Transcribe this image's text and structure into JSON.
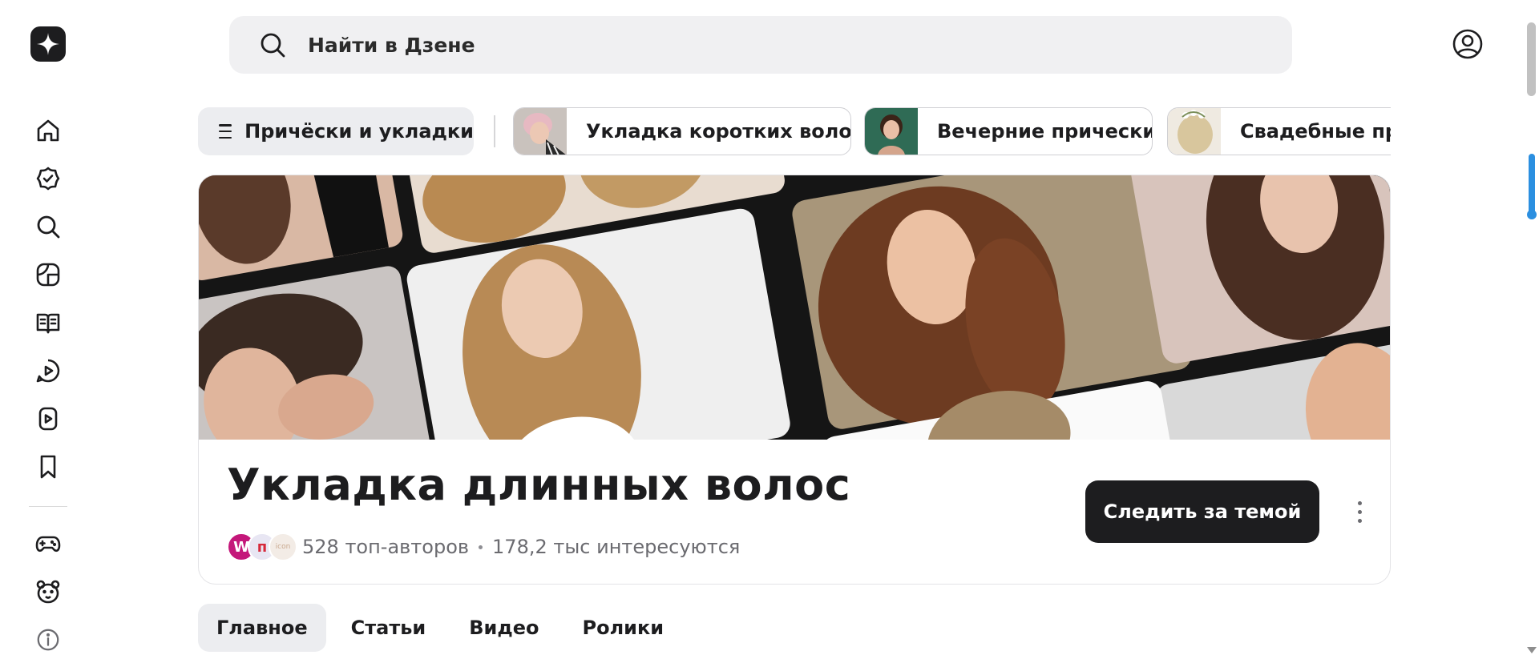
{
  "search": {
    "placeholder": "Найти в Дзене"
  },
  "rail": {
    "items": [
      {
        "icon": "home-icon"
      },
      {
        "icon": "subscriptions-icon"
      },
      {
        "icon": "search-icon"
      },
      {
        "icon": "news-icon"
      },
      {
        "icon": "book-icon"
      },
      {
        "icon": "clips-icon"
      },
      {
        "icon": "video-icon"
      },
      {
        "icon": "bookmark-icon"
      },
      {
        "icon": "gamepad-icon"
      },
      {
        "icon": "bear-icon"
      },
      {
        "icon": "info-icon"
      }
    ]
  },
  "topics": {
    "main_label": "Причёски и укладки",
    "chips": [
      {
        "label": "Укладка коротких волос"
      },
      {
        "label": "Вечерние прически"
      },
      {
        "label": "Свадебные прически"
      }
    ]
  },
  "hero": {
    "title": "Укладка длинных волос",
    "authors": "528 топ-авторов",
    "interested": "178,2 тыс интересуются",
    "avatars": [
      {
        "letter": "W",
        "color": "#c4177a"
      },
      {
        "letter": "п",
        "color": "#e8e6f3"
      },
      {
        "letter": "icon",
        "color": "#f3ece6"
      }
    ],
    "follow_label": "Следить за темой"
  },
  "tabs": [
    {
      "label": "Главное",
      "active": true
    },
    {
      "label": "Статьи",
      "active": false
    },
    {
      "label": "Видео",
      "active": false
    },
    {
      "label": "Ролики",
      "active": false
    }
  ],
  "colors": {
    "accent": "#1d1d1f",
    "scroll": "#2b8fe0"
  }
}
